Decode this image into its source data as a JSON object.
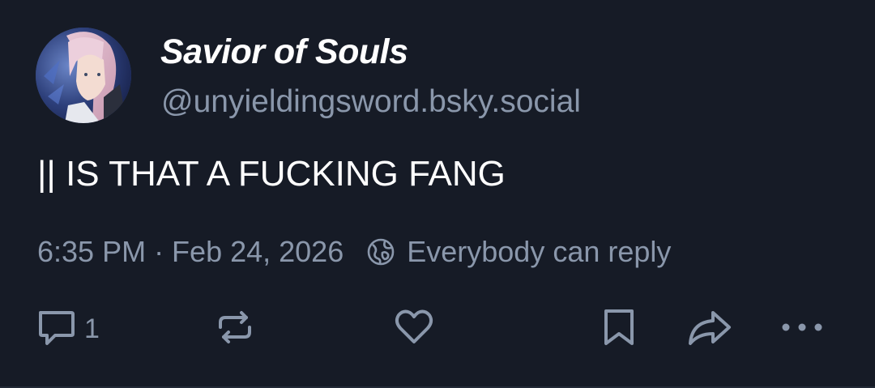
{
  "author": {
    "display_name": "Savior of Souls",
    "handle": "@unyieldingsword.bsky.social"
  },
  "post": {
    "text": "|| IS THAT A FUCKING FANG"
  },
  "meta": {
    "timestamp": "6:35 PM · Feb 24, 2026",
    "reply_setting": "Everybody can reply"
  },
  "actions": {
    "reply_count": "1"
  },
  "icons": {
    "reply": "speech-bubble-icon",
    "repost": "repost-arrows-icon",
    "like": "heart-icon",
    "bookmark": "bookmark-icon",
    "share": "share-arrow-icon",
    "more": "ellipsis-icon",
    "reply_setting": "globe-icon"
  },
  "colors": {
    "background": "#161b26",
    "text_primary": "#ffffff",
    "text_secondary": "#8a97ab"
  }
}
